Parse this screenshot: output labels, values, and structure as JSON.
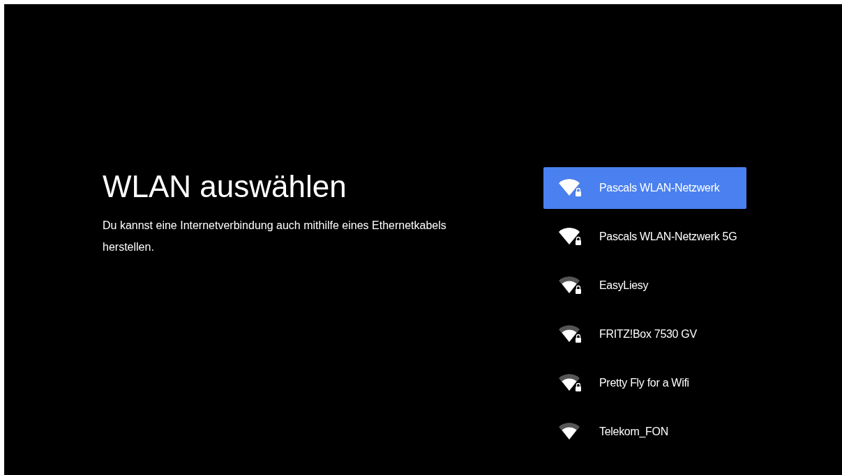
{
  "title": "WLAN auswählen",
  "description": "Du kannst eine Internetverbindung auch mithilfe eines Ethernetkabels herstellen.",
  "networks": [
    {
      "name": "Pascals WLAN-Netzwerk",
      "selected": true,
      "secured": true,
      "kind": "full"
    },
    {
      "name": "Pascals WLAN-Netzwerk 5G",
      "selected": false,
      "secured": true,
      "kind": "full"
    },
    {
      "name": "EasyLiesy",
      "selected": false,
      "secured": true,
      "kind": "high"
    },
    {
      "name": "FRITZ!Box 7530 GV",
      "selected": false,
      "secured": true,
      "kind": "high"
    },
    {
      "name": "Pretty Fly for a Wifi",
      "selected": false,
      "secured": true,
      "kind": "high"
    },
    {
      "name": "Telekom_FON",
      "selected": false,
      "secured": false,
      "kind": "high"
    }
  ]
}
